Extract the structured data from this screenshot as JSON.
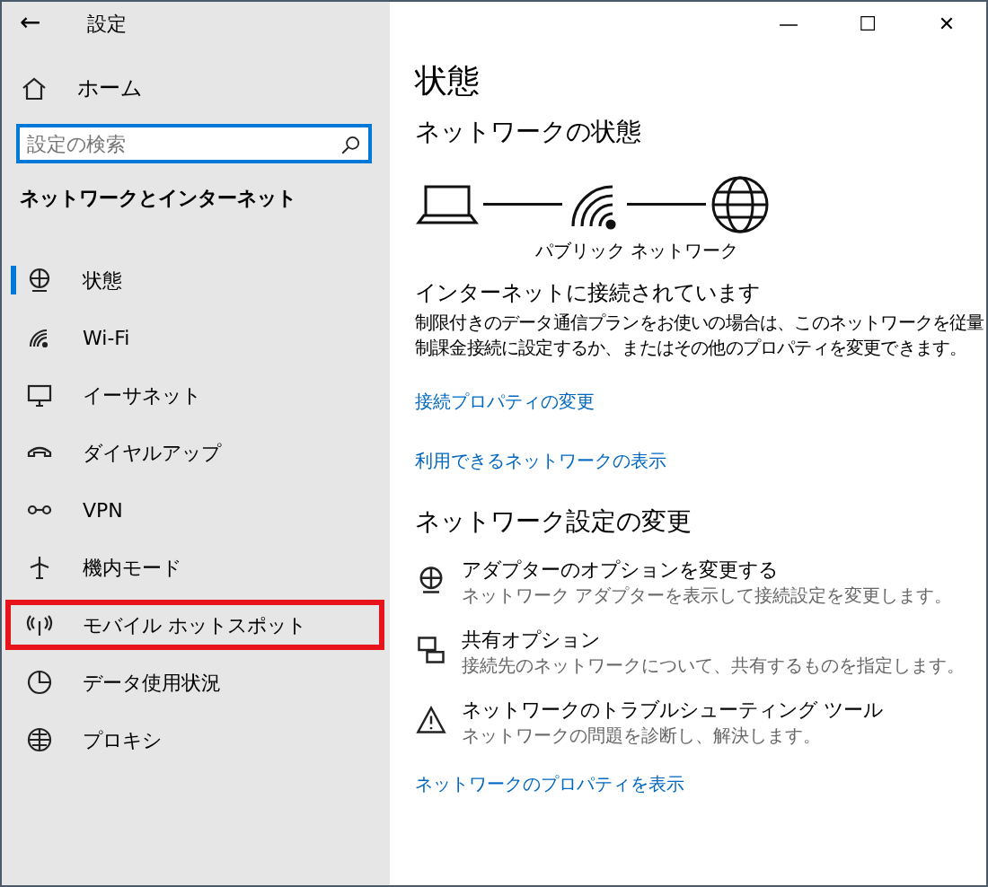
{
  "window": {
    "back": "←",
    "title": "設定",
    "controls": [
      "—",
      "☐",
      "✕"
    ]
  },
  "sidebar": {
    "home": "ホーム",
    "search": {
      "placeholder": "設定の検索"
    },
    "section": "ネットワークとインターネット",
    "items": [
      {
        "label": "状態",
        "selected": true,
        "highlighted": false
      },
      {
        "label": "Wi-Fi",
        "selected": false,
        "highlighted": false
      },
      {
        "label": "イーサネット",
        "selected": false,
        "highlighted": false
      },
      {
        "label": "ダイヤルアップ",
        "selected": false,
        "highlighted": false
      },
      {
        "label": "VPN",
        "selected": false,
        "highlighted": false
      },
      {
        "label": "機内モード",
        "selected": false,
        "highlighted": false
      },
      {
        "label": "モバイル ホットスポット",
        "selected": false,
        "highlighted": true
      },
      {
        "label": "データ使用状況",
        "selected": false,
        "highlighted": false
      },
      {
        "label": "プロキシ",
        "selected": false,
        "highlighted": false
      }
    ]
  },
  "main": {
    "title": "状態",
    "network_heading": "ネットワークの状態",
    "network_type": "パブリック ネットワーク",
    "status": "インターネットに接続されています",
    "description": "制限付きのデータ通信プランをお使いの場合は、このネットワークを従量制課金接続に設定するか、またはその他のプロパティを変更できます。",
    "links": [
      "接続プロパティの変更",
      "利用できるネットワークの表示"
    ],
    "change_heading": "ネットワーク設定の変更",
    "options": [
      {
        "title": "アダプターのオプションを変更する",
        "subtitle": "ネットワーク アダプターを表示して接続設定を変更します。"
      },
      {
        "title": "共有オプション",
        "subtitle": "接続先のネットワークについて、共有するものを指定します。"
      },
      {
        "title": "ネットワークのトラブルシューティング ツール",
        "subtitle": "ネットワークの問題を診断し、解決します。"
      }
    ],
    "bottom_link": "ネットワークのプロパティを表示"
  }
}
